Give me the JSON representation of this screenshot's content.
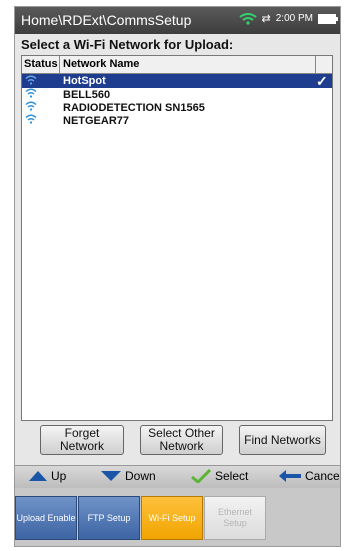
{
  "header": {
    "path": "Home\\RDExt\\CommsSetup",
    "time": "2:00 PM"
  },
  "title": "Select a Wi-Fi Network for Upload:",
  "table": {
    "columns": [
      "Status",
      "Network Name"
    ],
    "rows": [
      {
        "name": "HotSpot",
        "selected": true,
        "check": "✓"
      },
      {
        "name": "BELL560",
        "selected": false
      },
      {
        "name": "RADIODETECTION SN1565",
        "selected": false
      },
      {
        "name": "NETGEAR77",
        "selected": false
      }
    ]
  },
  "buttons": {
    "forget": "Forget Network",
    "select_other": "Select Other Network",
    "find": "Find Networks"
  },
  "softkeys": {
    "up": "Up",
    "down": "Down",
    "select": "Select",
    "cancel": "Cancel"
  },
  "tabs": [
    {
      "label": "Upload Enable",
      "state": "normal"
    },
    {
      "label": "FTP Setup",
      "state": "normal"
    },
    {
      "label": "Wi-Fi Setup",
      "state": "active"
    },
    {
      "label": "Ethernet Setup",
      "state": "disabled"
    }
  ],
  "colors": {
    "selection": "#1f3d8f",
    "accent": "#f0a400",
    "tab_blue": "#3d64a4",
    "wifi": "#2a8fd8"
  }
}
